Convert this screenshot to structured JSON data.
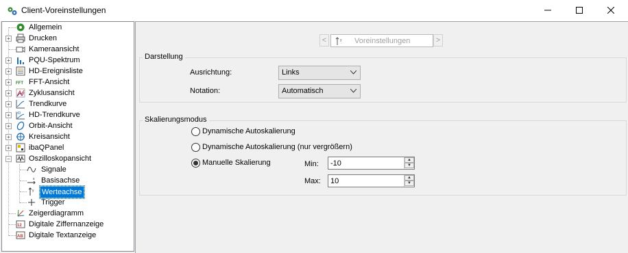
{
  "window": {
    "title": "Client-Voreinstellungen",
    "buttons": {
      "minimize": "minimize",
      "maximize": "maximize",
      "close": "close"
    }
  },
  "tree": {
    "items": [
      {
        "label": "Allgemein",
        "icon": "gear-icon"
      },
      {
        "label": "Drucken",
        "icon": "printer-icon"
      },
      {
        "label": "Kameraansicht",
        "icon": "camera-icon"
      },
      {
        "label": "PQU-Spektrum",
        "icon": "bar-chart-icon"
      },
      {
        "label": "HD-Ereignisliste",
        "icon": "list-icon"
      },
      {
        "label": "FFT-Ansicht",
        "icon": "fft-icon"
      },
      {
        "label": "Zyklusansicht",
        "icon": "cycle-icon"
      },
      {
        "label": "Trendkurve",
        "icon": "trend-icon"
      },
      {
        "label": "HD-Trendkurve",
        "icon": "hd-trend-icon"
      },
      {
        "label": "Orbit-Ansicht",
        "icon": "orbit-icon"
      },
      {
        "label": "Kreisansicht",
        "icon": "circle-icon"
      },
      {
        "label": "ibaQPanel",
        "icon": "panel-icon"
      },
      {
        "label": "Oszilloskopansicht",
        "icon": "oscilloscope-icon"
      },
      {
        "label": "Signale",
        "icon": "signal-icon"
      },
      {
        "label": "Basisachse",
        "icon": "x-axis-icon"
      },
      {
        "label": "Werteachse",
        "icon": "y-axis-icon"
      },
      {
        "label": "Trigger",
        "icon": "trigger-icon"
      },
      {
        "label": "Zeigerdiagramm",
        "icon": "pointer-diagram-icon"
      },
      {
        "label": "Digitale Ziffernanzeige",
        "icon": "digit-display-icon"
      },
      {
        "label": "Digitale Textanzeige",
        "icon": "text-display-icon"
      }
    ],
    "selected": "Werteachse"
  },
  "nav": {
    "label": "Voreinstellungen",
    "prev": "<",
    "next": ">"
  },
  "darstellung": {
    "title": "Darstellung",
    "ausrichtung_label": "Ausrichtung:",
    "ausrichtung_value": "Links",
    "notation_label": "Notation:",
    "notation_value": "Automatisch"
  },
  "skalierung": {
    "title": "Skalierungsmodus",
    "options": [
      {
        "label": "Dynamische Autoskalierung",
        "checked": false
      },
      {
        "label": "Dynamische Autoskalierung (nur vergrößern)",
        "checked": false
      },
      {
        "label": "Manuelle Skalierung",
        "checked": true
      }
    ],
    "min_label": "Min:",
    "min_value": "-10",
    "max_label": "Max:",
    "max_value": "10"
  }
}
